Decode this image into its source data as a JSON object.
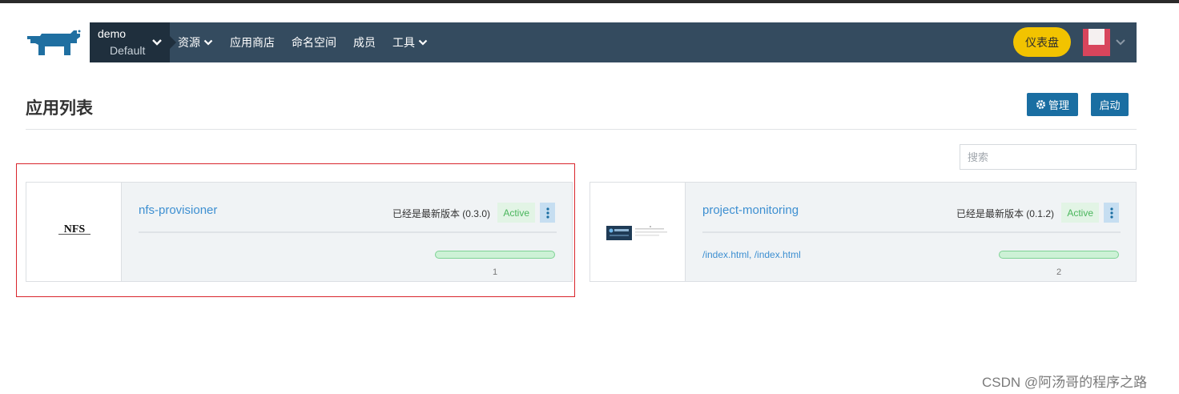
{
  "colors": {
    "navbar": "#344b5f",
    "env_switch": "#1f2f3d",
    "dashboard_button": "#f2c300",
    "primary_button": "#1a6ea2",
    "link": "#3d8fd1",
    "active_badge_bg": "#e2f4e5",
    "active_badge_text": "#4ab65c",
    "highlight_border": "#d9252c"
  },
  "header": {
    "logo_icon": "rancher-cow-icon",
    "env": {
      "project": "demo",
      "cluster": "Default"
    },
    "nav": [
      {
        "label": "资源",
        "dropdown": true
      },
      {
        "label": "应用商店",
        "dropdown": false
      },
      {
        "label": "命名空间",
        "dropdown": false
      },
      {
        "label": "成员",
        "dropdown": false
      },
      {
        "label": "工具",
        "dropdown": true
      }
    ],
    "dashboard_label": "仪表盘",
    "avatar_icon": "user-avatar-icon"
  },
  "page": {
    "title": "应用列表",
    "manage_label": "管理",
    "launch_label": "启动",
    "search_placeholder": "搜索"
  },
  "apps": [
    {
      "name": "nfs-provisioner",
      "logo_text": "NFS",
      "version_text": "已经是最新版本 (0.3.0)",
      "status": "Active",
      "endpoints": [],
      "progress": 1.0,
      "count": "1"
    },
    {
      "name": "project-monitoring",
      "logo_icon": "project-monitoring-logo",
      "version_text": "已经是最新版本 (0.1.2)",
      "status": "Active",
      "endpoints": [
        "/index.html",
        "/index.html"
      ],
      "progress": 1.0,
      "count": "2"
    }
  ],
  "watermark": "CSDN @阿汤哥的程序之路"
}
